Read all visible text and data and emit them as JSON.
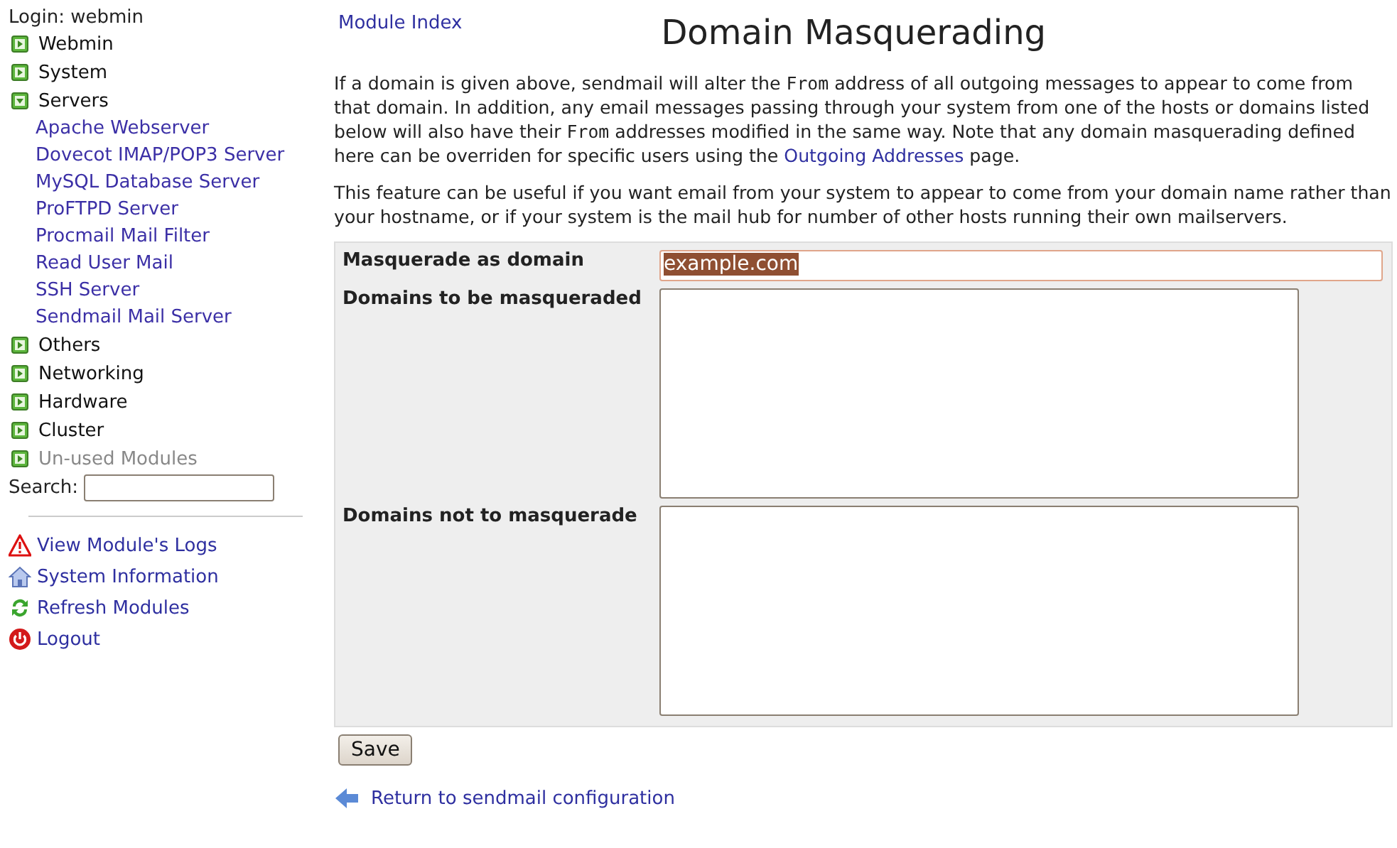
{
  "sidebar": {
    "login": "Login: webmin",
    "categories": [
      {
        "label": "Webmin",
        "expanded": false,
        "disabled": false
      },
      {
        "label": "System",
        "expanded": false,
        "disabled": false
      },
      {
        "label": "Servers",
        "expanded": true,
        "disabled": false,
        "children": [
          {
            "label": "Apache Webserver"
          },
          {
            "label": "Dovecot IMAP/POP3 Server"
          },
          {
            "label": "MySQL Database Server"
          },
          {
            "label": "ProFTPD Server"
          },
          {
            "label": "Procmail Mail Filter"
          },
          {
            "label": "Read User Mail"
          },
          {
            "label": "SSH Server"
          },
          {
            "label": "Sendmail Mail Server"
          }
        ]
      },
      {
        "label": "Others",
        "expanded": false,
        "disabled": false
      },
      {
        "label": "Networking",
        "expanded": false,
        "disabled": false
      },
      {
        "label": "Hardware",
        "expanded": false,
        "disabled": false
      },
      {
        "label": "Cluster",
        "expanded": false,
        "disabled": false
      },
      {
        "label": "Un-used Modules",
        "expanded": false,
        "disabled": true
      }
    ],
    "search_label": "Search:",
    "links": [
      {
        "kind": "warning",
        "label": "View Module's Logs"
      },
      {
        "kind": "home",
        "label": "System Information"
      },
      {
        "kind": "refresh",
        "label": "Refresh Modules"
      },
      {
        "kind": "power",
        "label": "Logout"
      }
    ]
  },
  "main": {
    "module_index": "Module Index",
    "title": "Domain Masquerading",
    "paragraphs": [
      [
        {
          "kind": "text",
          "text": "If a domain is given above, sendmail will alter the "
        },
        {
          "kind": "code",
          "text": "From"
        },
        {
          "kind": "text",
          "text": " address of all outgoing messages to appear to come from that domain. In addition, any email messages passing through your system from one of the hosts or domains listed below will also have their "
        },
        {
          "kind": "code",
          "text": "From"
        },
        {
          "kind": "text",
          "text": " addresses modified in the same way. Note that any domain masquerading defined here can be overriden for specific users using the "
        },
        {
          "kind": "link",
          "text": "Outgoing Addresses"
        },
        {
          "kind": "text",
          "text": " page."
        }
      ],
      [
        {
          "kind": "text",
          "text": "This feature can be useful if you want email from your system to appear to come from your domain name rather than your hostname, or if your system is the mail hub for number of other hosts running their own mailservers."
        }
      ]
    ],
    "form": [
      {
        "kind": "input",
        "label": "Masquerade as domain",
        "value": "example.com",
        "focused": true
      },
      {
        "kind": "textarea",
        "label": "Domains to be masqueraded"
      },
      {
        "kind": "textarea",
        "label": "Domains not to masquerade"
      }
    ],
    "save_button": "Save",
    "return_link": "Return to sendmail configuration"
  }
}
